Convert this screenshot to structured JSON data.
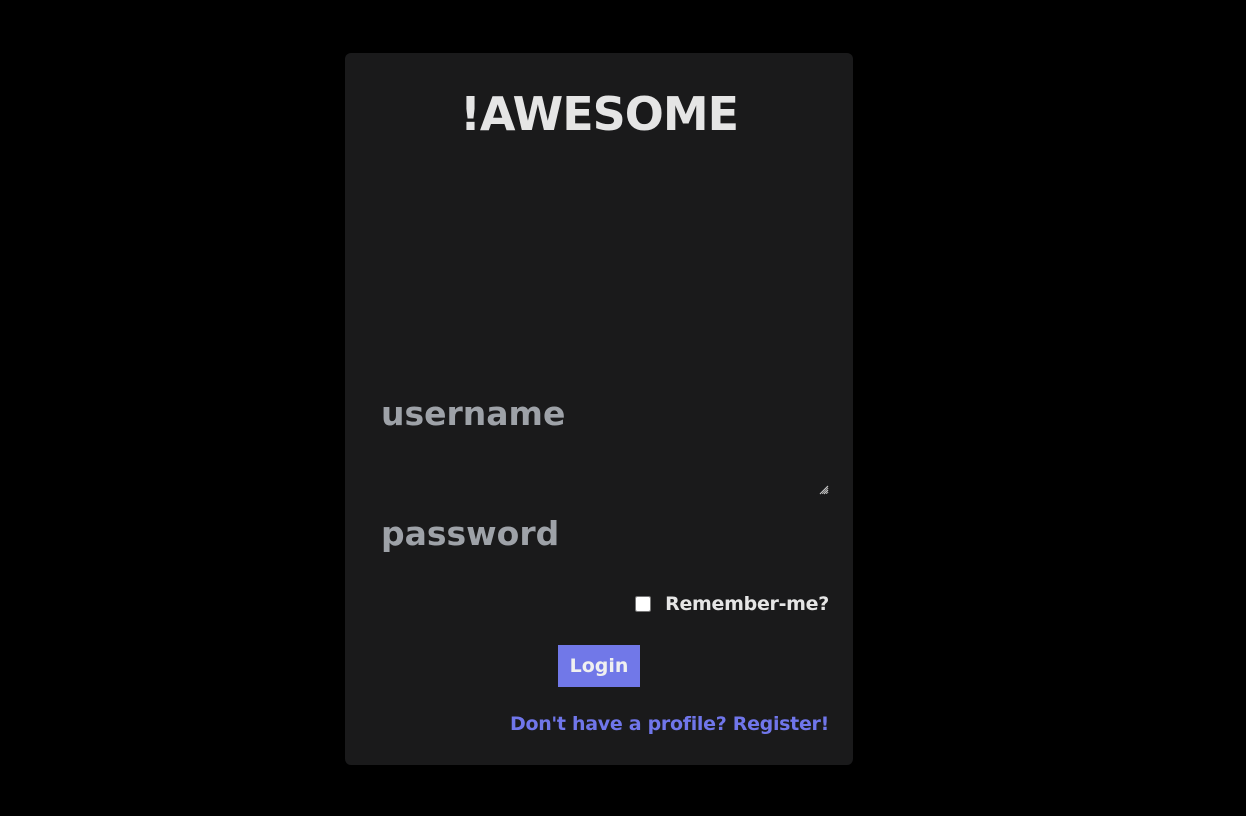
{
  "login_card": {
    "title": "!AWESOME",
    "username_placeholder": "username",
    "password_placeholder": "password",
    "remember_label": "Remember-me?",
    "remember_checked": false,
    "login_label": "Login",
    "register_link": "Don't have a profile? Register!"
  },
  "colors": {
    "page_background": "#000000",
    "card_background": "#1a1a1b",
    "accent": "#7178e8",
    "link": "#7076ea",
    "text": "#e5e5e5",
    "placeholder": "#9ea2a8"
  }
}
